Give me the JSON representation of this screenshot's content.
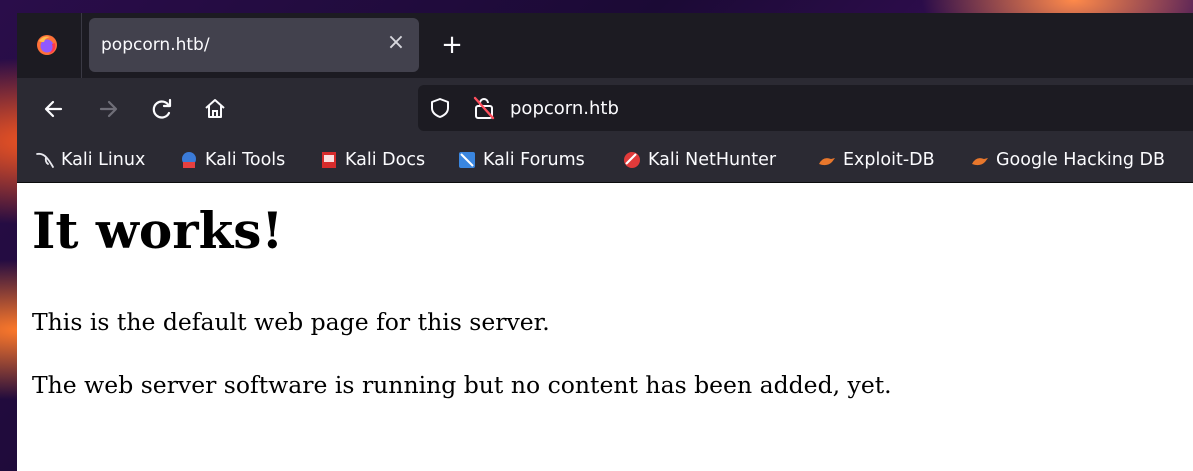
{
  "browser": {
    "tab": {
      "title": "popcorn.htb/",
      "close": "×"
    },
    "new_tab": "+",
    "address": "popcorn.htb",
    "bookmarks": [
      {
        "label": "Kali Linux",
        "icon": "kali-dragon-icon"
      },
      {
        "label": "Kali Tools",
        "icon": "kali-tools-icon"
      },
      {
        "label": "Kali Docs",
        "icon": "kali-docs-icon"
      },
      {
        "label": "Kali Forums",
        "icon": "kali-forums-icon"
      },
      {
        "label": "Kali NetHunter",
        "icon": "kali-nethunter-icon"
      },
      {
        "label": "Exploit-DB",
        "icon": "exploit-db-icon"
      },
      {
        "label": "Google Hacking DB",
        "icon": "ghdb-icon"
      }
    ]
  },
  "page": {
    "heading": "It works!",
    "para1": "This is the default web page for this server.",
    "para2": "The web server software is running but no content has been added, yet."
  }
}
